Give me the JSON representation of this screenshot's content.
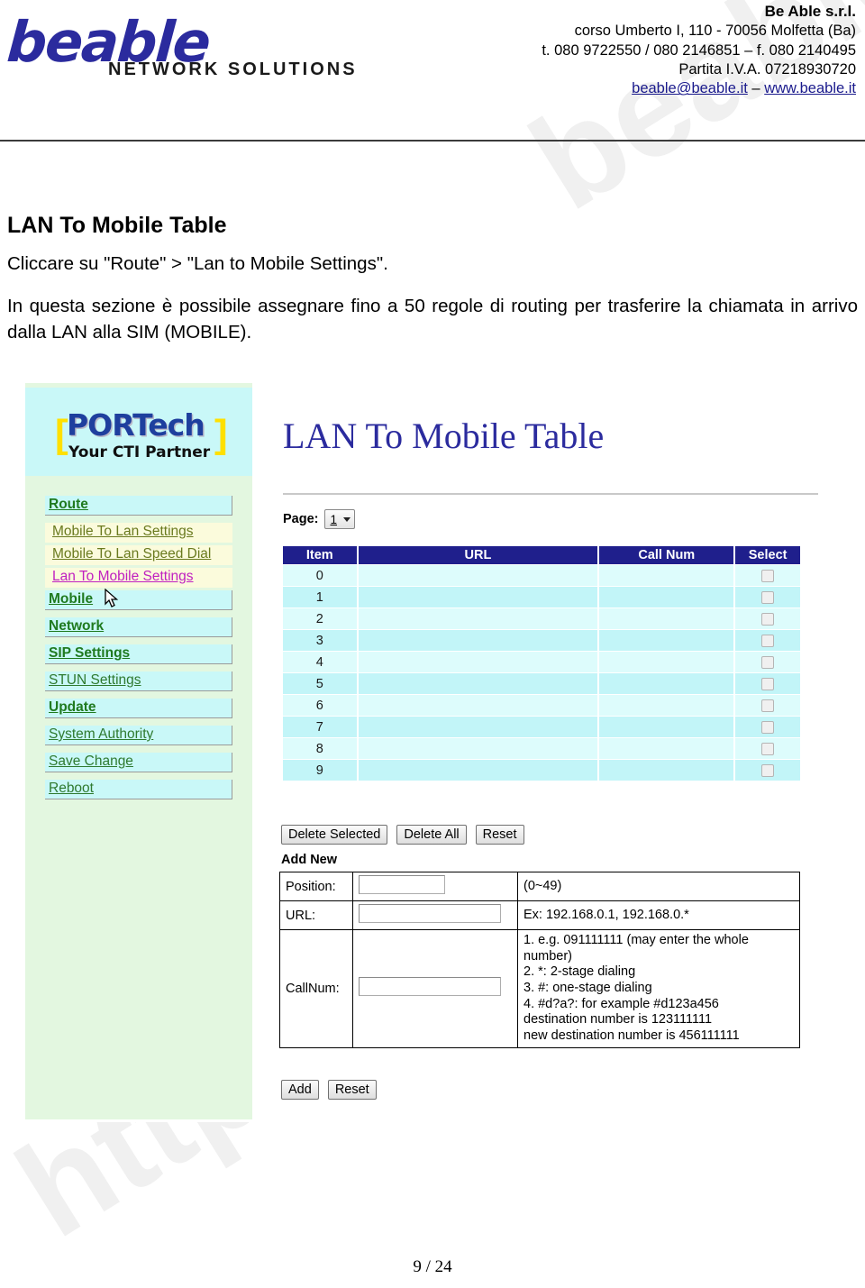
{
  "watermark": {
    "top_text": "beable.it",
    "bottom_text": "http"
  },
  "header": {
    "logo": {
      "wordmark": "beable",
      "tagline": "NETWORK SOLUTIONS"
    },
    "company": {
      "name": "Be Able s.r.l.",
      "address": "corso Umberto I, 110 - 70056 Molfetta (Ba)",
      "phone": "t. 080 9722550 / 080 2146851 – f.  080 2140495",
      "vat": "Partita I.V.A. 07218930720",
      "email": "beable@beable.it",
      "contact_separator": " – ",
      "website": "www.beable.it"
    }
  },
  "document": {
    "title": "LAN To Mobile Table",
    "intro": "Cliccare su \"Route\" > \"Lan to Mobile Settings\".",
    "paragraph": "In questa sezione è possibile assegnare fino a 50 regole di routing per trasferire la chiamata in arrivo dalla LAN alla SIM (MOBILE)."
  },
  "screenshot": {
    "sidebar": {
      "brand": {
        "name": "PORTech",
        "tagline": "Your CTI Partner",
        "bracket_left": "[",
        "bracket_right": "]"
      },
      "menu": [
        {
          "label": "Route",
          "type": "top",
          "style": "bold"
        },
        {
          "label": "Mobile To Lan Settings",
          "type": "sub",
          "active": false
        },
        {
          "label": "Mobile To Lan Speed Dial",
          "type": "sub",
          "active": false
        },
        {
          "label": "Lan To Mobile Settings",
          "type": "sub",
          "active": true
        },
        {
          "label": "Mobile",
          "type": "top",
          "style": "bold"
        },
        {
          "label": "Network",
          "type": "top",
          "style": "bold"
        },
        {
          "label": "SIP Settings",
          "type": "top",
          "style": "bold"
        },
        {
          "label": "STUN Settings",
          "type": "top",
          "style": "plain"
        },
        {
          "label": "Update",
          "type": "top",
          "style": "bold"
        },
        {
          "label": "System Authority",
          "type": "top",
          "style": "plain"
        },
        {
          "label": "Save Change",
          "type": "top",
          "style": "plain"
        },
        {
          "label": "Reboot",
          "type": "top",
          "style": "plain"
        }
      ]
    },
    "panel": {
      "title": "LAN To Mobile Table",
      "page_label": "Page:",
      "page_value": "1",
      "table": {
        "columns": [
          "Item",
          "URL",
          "Call Num",
          "Select"
        ],
        "rows": [
          {
            "item": "0",
            "url": "",
            "call_num": "",
            "selected": false
          },
          {
            "item": "1",
            "url": "",
            "call_num": "",
            "selected": false
          },
          {
            "item": "2",
            "url": "",
            "call_num": "",
            "selected": false
          },
          {
            "item": "3",
            "url": "",
            "call_num": "",
            "selected": false
          },
          {
            "item": "4",
            "url": "",
            "call_num": "",
            "selected": false
          },
          {
            "item": "5",
            "url": "",
            "call_num": "",
            "selected": false
          },
          {
            "item": "6",
            "url": "",
            "call_num": "",
            "selected": false
          },
          {
            "item": "7",
            "url": "",
            "call_num": "",
            "selected": false
          },
          {
            "item": "8",
            "url": "",
            "call_num": "",
            "selected": false
          },
          {
            "item": "9",
            "url": "",
            "call_num": "",
            "selected": false
          }
        ]
      },
      "table_actions": {
        "delete_selected": "Delete Selected",
        "delete_all": "Delete All",
        "reset": "Reset"
      },
      "add_new": {
        "heading": "Add New",
        "position_label": "Position:",
        "position_value": "",
        "position_hint": "(0~49)",
        "url_label": "URL:",
        "url_value": "",
        "url_hint": "Ex: 192.168.0.1, 192.168.0.*",
        "callnum_label": "CallNum:",
        "callnum_value": "",
        "callnum_hints": [
          "1. e.g. 091111111 (may enter the whole number)",
          "2. *: 2-stage dialing",
          "3. #: one-stage dialing",
          "4. #d?a?: for example #d123a456",
          "destination number is 123111111",
          "new destination number is 456111111"
        ],
        "add_button": "Add",
        "reset_button": "Reset"
      }
    }
  },
  "footer": {
    "page_number": "9 / 24"
  },
  "colors": {
    "brand_blue": "#2b2b9e",
    "table_header": "#1f1f8c",
    "row_odd": "#ddfcfc",
    "row_even": "#c2f5f8",
    "sidebar_green": "#e3f7e0",
    "sidebar_cyan": "#c9f8f8",
    "active_link": "#c020c0",
    "menu_green": "#1f7a1f"
  }
}
